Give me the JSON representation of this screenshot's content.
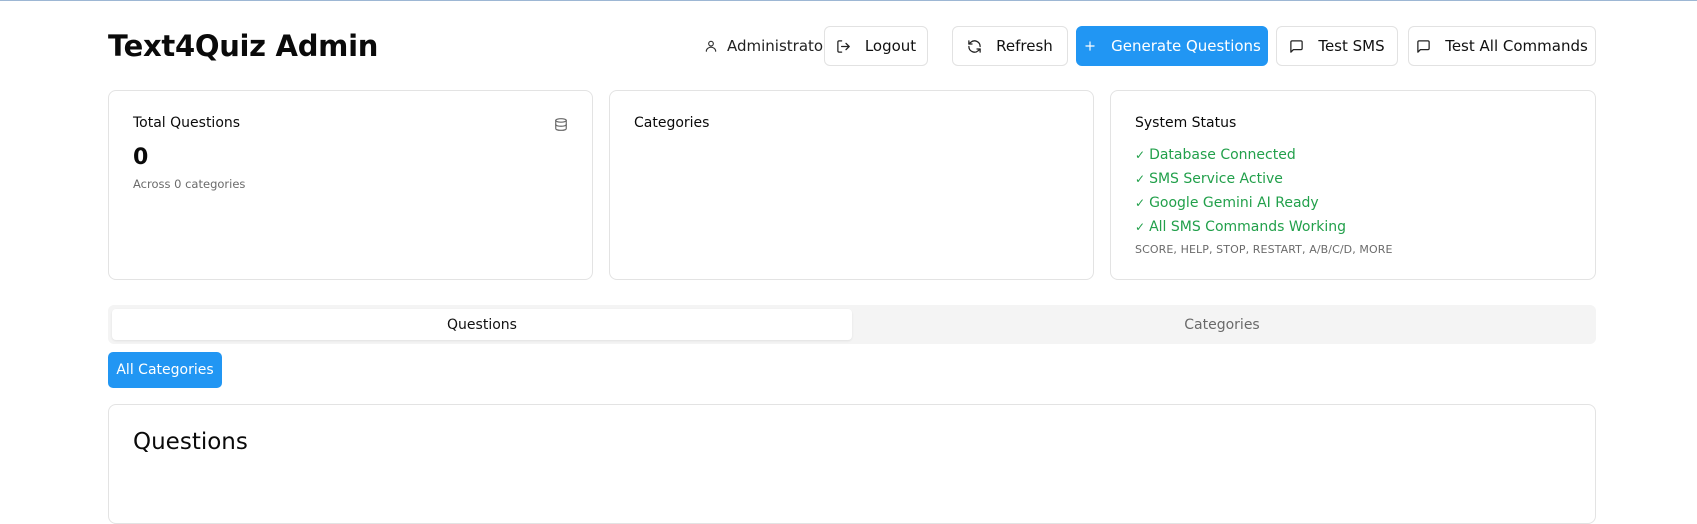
{
  "header": {
    "title": "Text4Quiz Admin",
    "user_label": "Administrator",
    "logout_label": "Logout",
    "refresh_label": "Refresh",
    "generate_label": "Generate Questions",
    "test_sms_label": "Test SMS",
    "test_all_label": "Test All Commands"
  },
  "cards": {
    "total": {
      "title": "Total Questions",
      "value": "0",
      "subtitle": "Across 0 categories"
    },
    "categories": {
      "title": "Categories"
    },
    "status": {
      "title": "System Status",
      "items": [
        "Database Connected",
        "SMS Service Active",
        "Google Gemini AI Ready",
        "All SMS Commands Working"
      ],
      "note": "SCORE, HELP, STOP, RESTART, A/B/C/D, MORE"
    }
  },
  "tabs": [
    {
      "label": "Questions",
      "active": true
    },
    {
      "label": "Categories",
      "active": false
    }
  ],
  "filter": {
    "all_categories_label": "All Categories"
  },
  "panel": {
    "title": "Questions"
  },
  "colors": {
    "primary": "#2196f3",
    "success": "#22a04b",
    "border": "#e3e3e3",
    "muted": "#6b6b6b"
  }
}
